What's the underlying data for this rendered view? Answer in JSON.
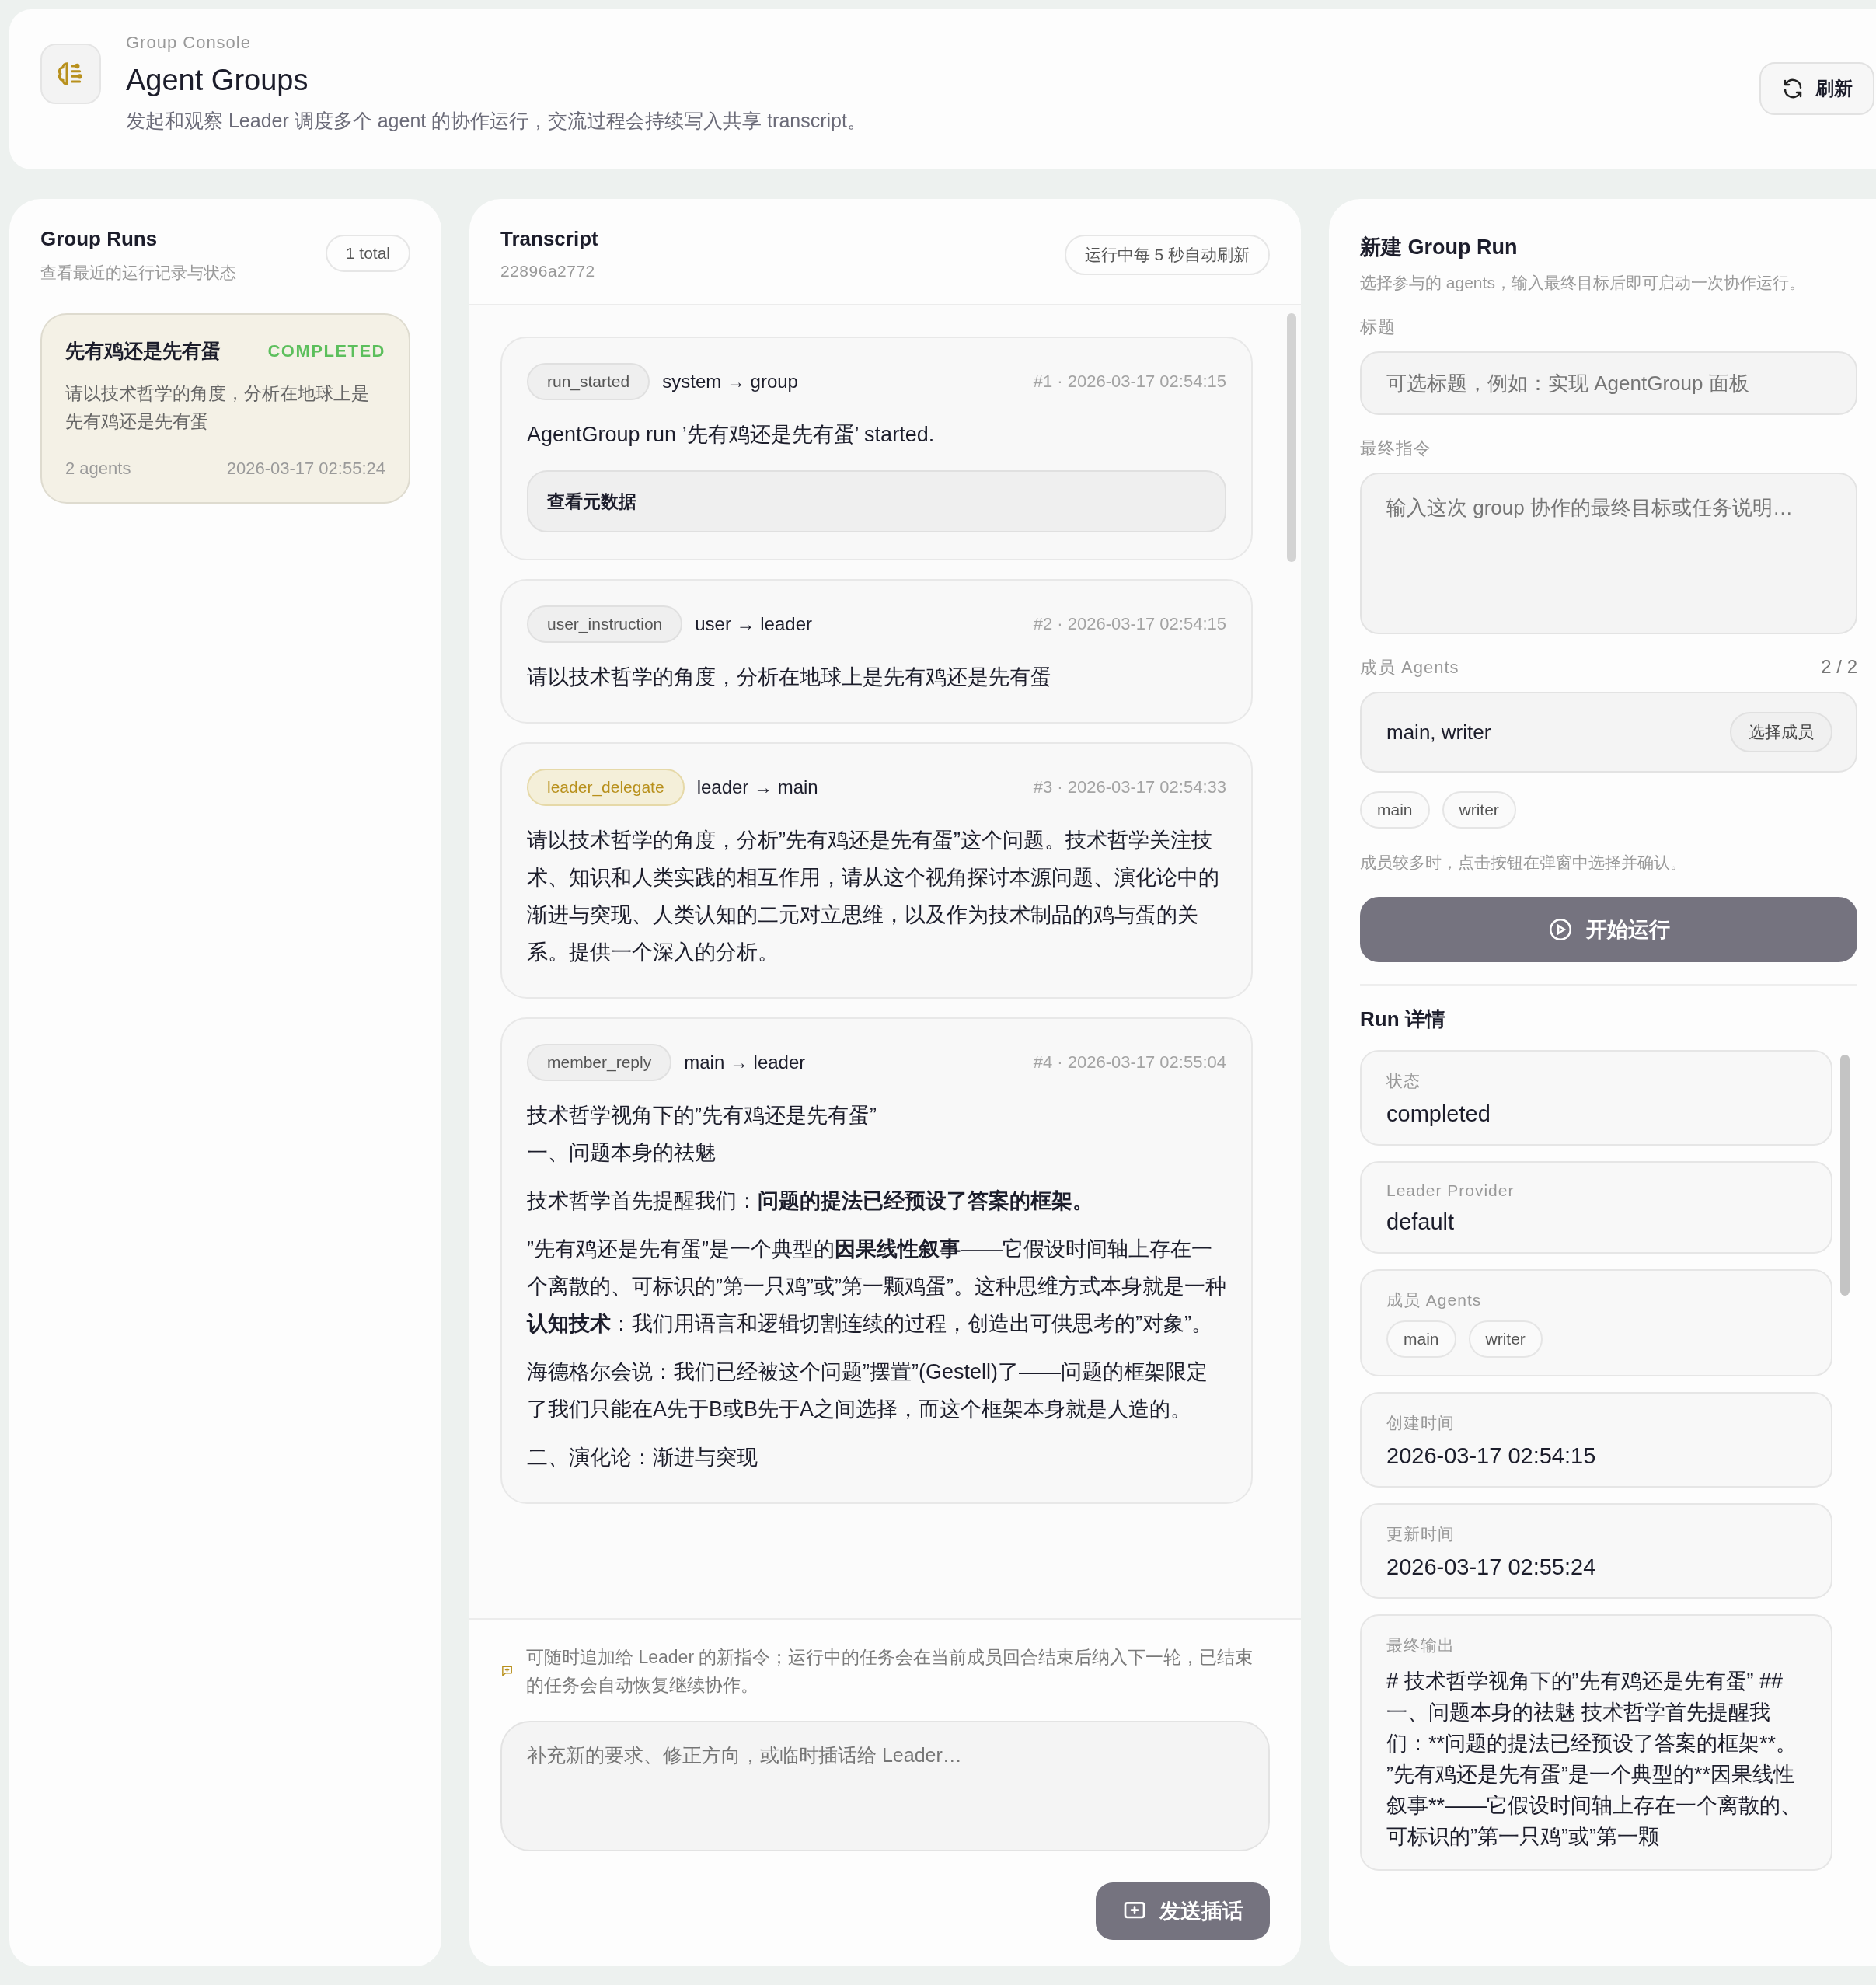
{
  "header": {
    "eyebrow": "Group Console",
    "title": "Agent Groups",
    "subtitle": "发起和观察 Leader 调度多个 agent 的协作运行，交流过程会持续写入共享 transcript。",
    "refresh_button": "刷新"
  },
  "runs_panel": {
    "title": "Group Runs",
    "subtitle": "查看最近的运行记录与状态",
    "count": "1 total",
    "runs": [
      {
        "title": "先有鸡还是先有蛋",
        "status": "COMPLETED",
        "summary": "请以技术哲学的角度，分析在地球上是先有鸡还是先有蛋",
        "agents": "2 agents",
        "time": "2026-03-17 02:55:24",
        "selected": true
      }
    ]
  },
  "transcript": {
    "title": "Transcript",
    "run_id": "22896a2772",
    "refresh_note": "运行中每 5 秒自动刷新",
    "messages": [
      {
        "type": "run_started",
        "highlighted": false,
        "route": "system → group",
        "meta": "#1 · 2026-03-17 02:54:15",
        "paragraphs": [
          [
            "AgentGroup run ’先有鸡还是先有蛋’ started."
          ]
        ],
        "metadata_button": "查看元数据"
      },
      {
        "type": "user_instruction",
        "highlighted": false,
        "route": "user → leader",
        "meta": "#2 · 2026-03-17 02:54:15",
        "paragraphs": [
          [
            "请以技术哲学的角度，分析在地球上是先有鸡还是先有蛋"
          ]
        ]
      },
      {
        "type": "leader_delegate",
        "highlighted": true,
        "route": "leader → main",
        "meta": "#3 · 2026-03-17 02:54:33",
        "paragraphs": [
          [
            "请以技术哲学的角度，分析”先有鸡还是先有蛋”这个问题。技术哲学关注技术、知识和人类实践的相互作用，请从这个视角探讨本源问题、演化论中的渐进与突现、人类认知的二元对立思维，以及作为技术制品的鸡与蛋的关系。提供一个深入的分析。"
          ]
        ]
      },
      {
        "type": "member_reply",
        "highlighted": false,
        "route": "main → leader",
        "meta": "#4 · 2026-03-17 02:55:04",
        "paragraphs": [
          [
            "技术哲学视角下的”先有鸡还是先有蛋”",
            "一、问题本身的祛魅"
          ],
          [
            "技术哲学首先提醒我们：**问题的提法已经预设了答案的框架。**"
          ],
          [
            "”先有鸡还是先有蛋”是一个典型的**因果线性叙事**——它假设时间轴上存在一个离散的、可标识的”第一只鸡”或”第一颗鸡蛋”。这种思维方式本身就是一种**认知技术**：我们用语言和逻辑切割连续的过程，创造出可供思考的”对象”。"
          ],
          [
            "海德格尔会说：我们已经被这个问题”摆置”(Gestell)了——问题的框架限定了我们只能在A先于B或B先于A之间选择，而这个框架本身就是人造的。"
          ],
          [
            "二、演化论：渐进与突现"
          ]
        ]
      }
    ],
    "composer": {
      "hint": "可随时追加给 Leader 的新指令；运行中的任务会在当前成员回合结束后纳入下一轮，已结束的任务会自动恢复继续协作。",
      "placeholder": "补充新的要求、修正方向，或临时插话给 Leader…",
      "send_button": "发送插话"
    }
  },
  "new_run": {
    "title": "新建 Group Run",
    "subtitle": "选择参与的 agents，输入最终目标后即可启动一次协作运行。",
    "title_label": "标题",
    "title_placeholder": "可选标题，例如：实现 AgentGroup 面板",
    "instruction_label": "最终指令",
    "instruction_placeholder": "输入这次 group 协作的最终目标或任务说明…",
    "members_label": "成员 Agents",
    "members_count": "2 / 2",
    "members_value": "main, writer",
    "choose_button": "选择成员",
    "member_tags": [
      "main",
      "writer"
    ],
    "members_hint": "成员较多时，点击按钮在弹窗中选择并确认。",
    "start_button": "开始运行"
  },
  "run_details": {
    "title": "Run 详情",
    "items": [
      {
        "kind": "text",
        "label": "状态",
        "value": "completed"
      },
      {
        "kind": "text",
        "label": "Leader Provider",
        "value": "default"
      },
      {
        "kind": "tags",
        "label": "成员 Agents",
        "tags": [
          "main",
          "writer"
        ]
      },
      {
        "kind": "text",
        "label": "创建时间",
        "value": "2026-03-17 02:54:15"
      },
      {
        "kind": "text",
        "label": "更新时间",
        "value": "2026-03-17 02:55:24"
      },
      {
        "kind": "output",
        "label": "最终输出",
        "value": "# 技术哲学视角下的”先有鸡还是先有蛋” ## 一、问题本身的祛魅 技术哲学首先提醒我们：**问题的提法已经预设了答案的框架**。 ”先有鸡还是先有蛋”是一个典型的**因果线性叙事**——它假设时间轴上存在一个离散的、可标识的”第一只鸡”或”第一颗"
      }
    ]
  }
}
